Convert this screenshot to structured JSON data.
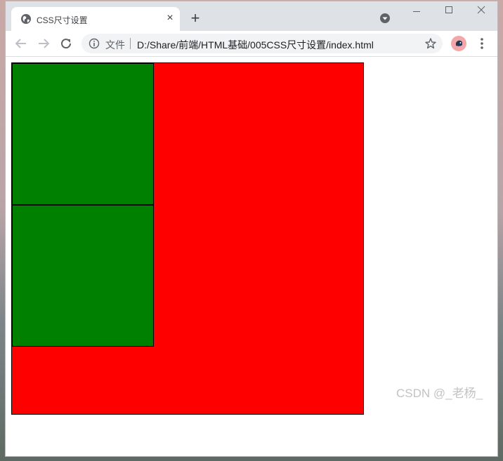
{
  "tab": {
    "title": "CSS尺寸设置",
    "close_glyph": "×",
    "favicon": "globe-icon"
  },
  "new_tab_glyph": "+",
  "window_controls": [
    "minimize",
    "maximize",
    "close"
  ],
  "omnibox": {
    "site_label": "文件",
    "url": "D:/Share/前端/HTML基础/005CSS尺寸设置/index.html"
  },
  "page": {
    "outer_color": "#ff0000",
    "inner_color": "#008000",
    "border_color": "#000000"
  },
  "watermark": "CSDN @_老杨_"
}
